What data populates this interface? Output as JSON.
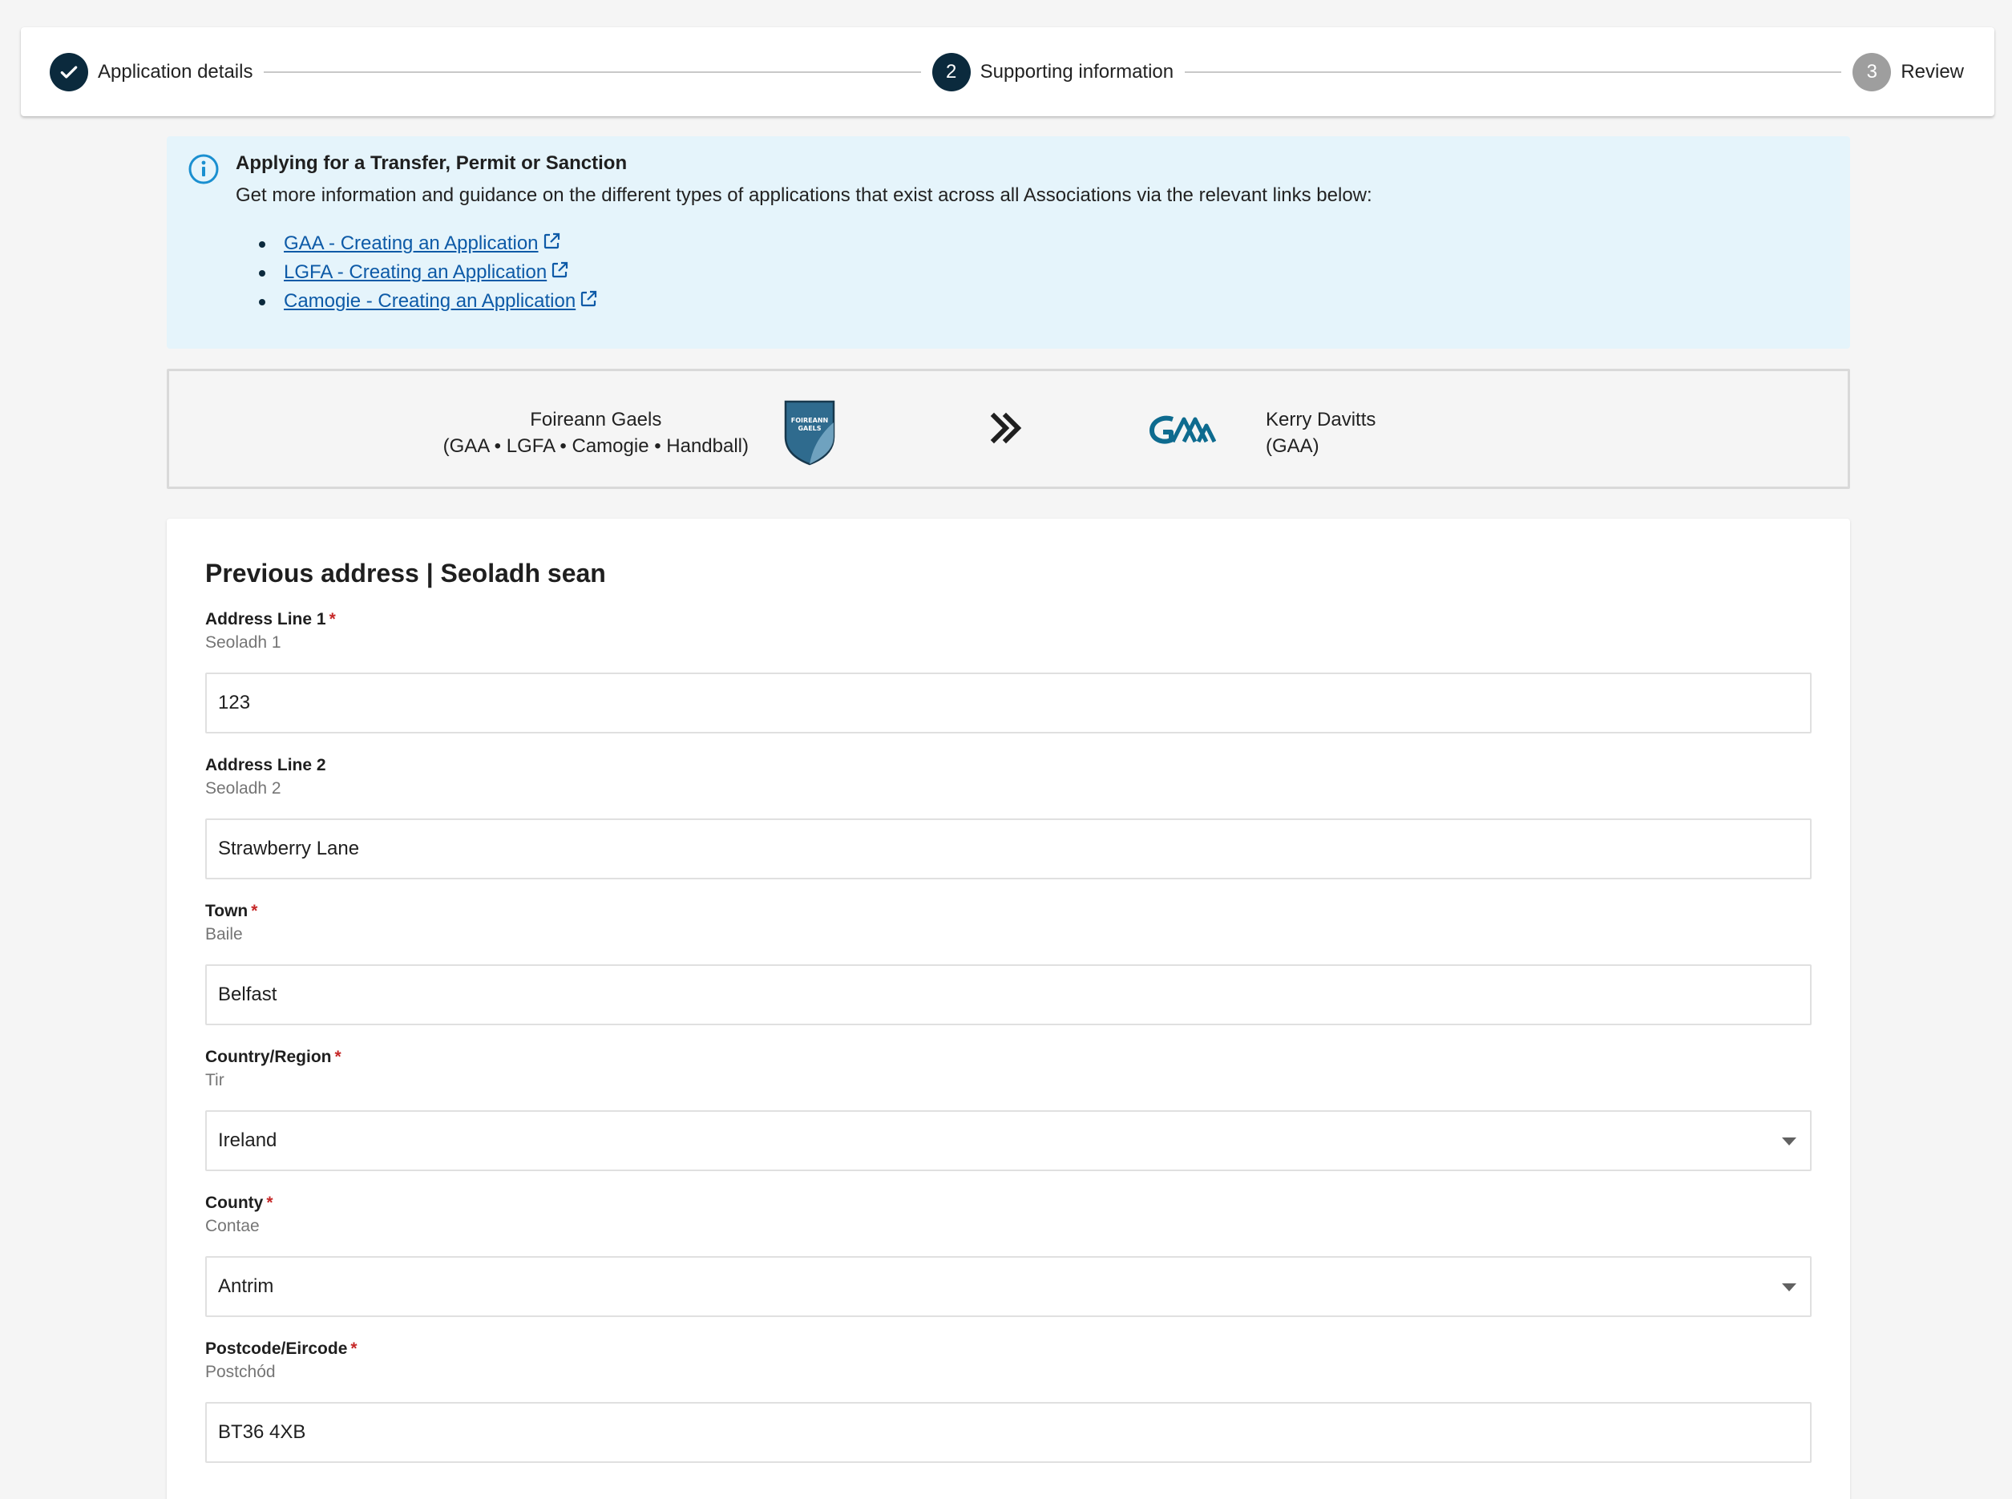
{
  "stepper": {
    "steps": [
      {
        "number": "",
        "label": "Application details",
        "state": "done"
      },
      {
        "number": "2",
        "label": "Supporting information",
        "state": "active"
      },
      {
        "number": "3",
        "label": "Review",
        "state": "pending"
      }
    ]
  },
  "info": {
    "icon": "info-icon",
    "title": "Applying for a Transfer, Permit or Sanction",
    "text": "Get more information and guidance on the different types of applications that exist across all Associations via the relevant links below:",
    "links": [
      {
        "label": "GAA - Creating an Application",
        "icon": "external-link-icon"
      },
      {
        "label": "LGFA - Creating an Application",
        "icon": "external-link-icon"
      },
      {
        "label": "Camogie - Creating an Application",
        "icon": "external-link-icon"
      }
    ]
  },
  "transfer": {
    "from": {
      "name": "Foireann Gaels",
      "associations": "(GAA • LGFA • Camogie • Handball)",
      "crest_text": "FOIREANN GAELS"
    },
    "arrow_icon": "double-chevron-right-icon",
    "to": {
      "name": "Kerry Davitts",
      "associations": "(GAA)"
    }
  },
  "form": {
    "title": "Previous address | Seoladh sean",
    "fields": [
      {
        "label": "Address Line 1",
        "sublabel": "Seoladh 1",
        "required": "*",
        "value": "123",
        "type": "text"
      },
      {
        "label": "Address Line 2",
        "sublabel": "Seoladh 2",
        "required": "",
        "value": "Strawberry Lane",
        "type": "text"
      },
      {
        "label": "Town",
        "sublabel": "Baile",
        "required": "*",
        "value": "Belfast",
        "type": "text"
      },
      {
        "label": "Country/Region",
        "sublabel": "Tir",
        "required": "*",
        "value": "Ireland",
        "type": "select"
      },
      {
        "label": "County",
        "sublabel": "Contae",
        "required": "*",
        "value": "Antrim",
        "type": "select"
      },
      {
        "label": "Postcode/Eircode",
        "sublabel": "Postchód",
        "required": "*",
        "value": "BT36 4XB",
        "type": "text"
      }
    ]
  },
  "colors": {
    "primary": "#0b2a3d",
    "link": "#0d5aa7",
    "info_bg": "#e5f4fb",
    "required": "#c62828"
  }
}
